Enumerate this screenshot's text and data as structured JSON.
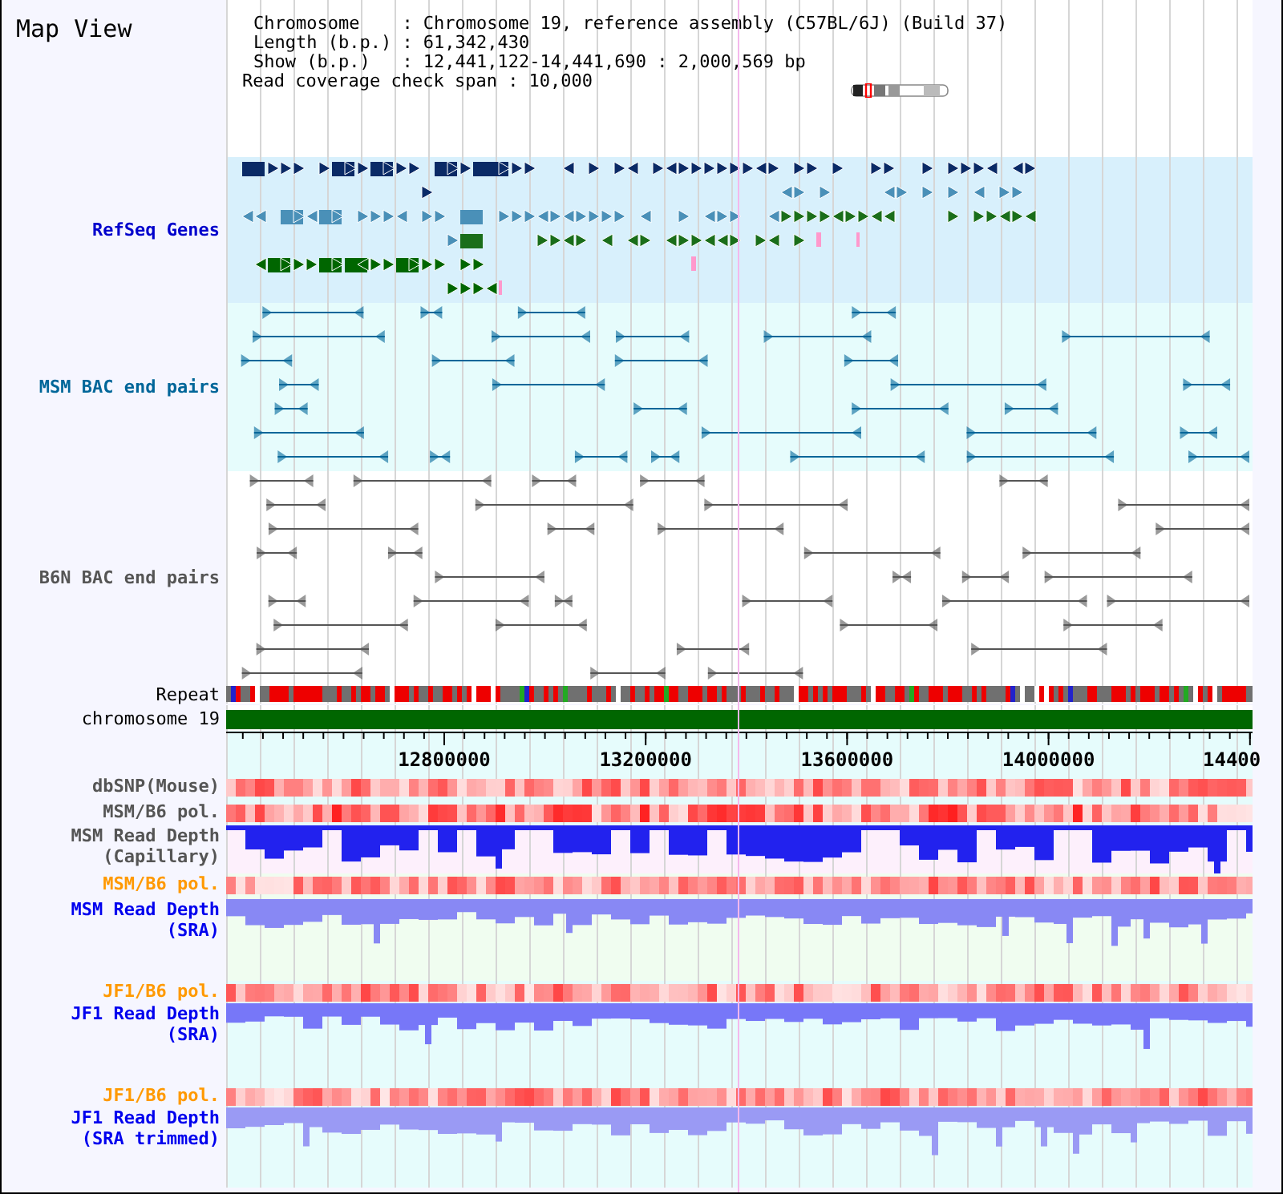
{
  "title": "Map View",
  "info": [
    {
      "label": "Chromosome",
      "sep": ":",
      "value": "Chromosome 19, reference assembly (C57BL/6J) (Build 37)"
    },
    {
      "label": "Length (b.p.)",
      "sep": ":",
      "value": "61,342,430"
    },
    {
      "label": "Show (b.p.)",
      "sep": ":",
      "value": "12,441,122-14,441,690 : 2,000,569 bp"
    }
  ],
  "coverage": {
    "label": "Read coverage check span",
    "sep": ":",
    "value": "10,000"
  },
  "upper_tracks": [
    {
      "kind": "genes",
      "label": "RefSeq Genes",
      "color": "#0000cc"
    },
    {
      "kind": "bac_pairs",
      "label": "MSM BAC end pairs",
      "color": "#006699"
    },
    {
      "kind": "bac_pairs",
      "label": "B6N BAC end pairs",
      "color": "#555555"
    },
    {
      "kind": "repeat",
      "label": "Repeat",
      "color": "#000000"
    },
    {
      "kind": "chromosome",
      "label": "chromosome 19",
      "color": "#000000"
    }
  ],
  "axis": {
    "labels": [
      "12800000",
      "13200000",
      "13600000",
      "14000000",
      "14400"
    ]
  },
  "lower_tracks": [
    {
      "kind": "heat",
      "label": "dbSNP(Mouse)",
      "color": "#555555"
    },
    {
      "kind": "heat",
      "label": "MSM/B6 pol.",
      "color": "#555555"
    },
    {
      "kind": "depth",
      "label": "MSM Read Depth (Capillary)",
      "color": "#555555"
    },
    {
      "kind": "heat",
      "label": "MSM/B6 pol.",
      "color": "#ff9900"
    },
    {
      "kind": "depth",
      "label": "MSM Read Depth (SRA)",
      "color": "#0000ee"
    },
    {
      "kind": "heat",
      "label": "JF1/B6 pol.",
      "color": "#ff9900"
    },
    {
      "kind": "depth",
      "label": "JF1 Read Depth (SRA)",
      "color": "#0000ee"
    },
    {
      "kind": "heat",
      "label": "JF1/B6 pol.",
      "color": "#ff9900"
    },
    {
      "kind": "depth",
      "label": "JF1 Read Depth (SRA trimmed)",
      "color": "#0000ee"
    }
  ]
}
